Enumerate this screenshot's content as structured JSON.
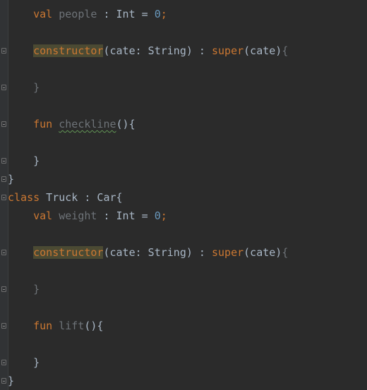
{
  "colors": {
    "background": "#2b2b2b",
    "keyword": "#cc7832",
    "number": "#6897bb",
    "text": "#a9b7c6",
    "muted": "#6e7378",
    "highlight": "#4b4a33"
  },
  "code": {
    "kw_val": "val",
    "people_decl_id": "people",
    "people_type": " : Int = ",
    "zero": "0",
    "semi": ";",
    "kw_constructor": "constructor",
    "ctor_params": "(cate: String) : ",
    "kw_super": "super",
    "super_args": "(cate)",
    "brace_open": "{",
    "brace_close": "}",
    "kw_fun": "fun",
    "checkline_name": "checkline",
    "paren_brace": "(){",
    "kw_class": "class",
    "truck_decl": " Truck : Car{",
    "weight_decl_id": "weight",
    "lift_name": "lift"
  }
}
